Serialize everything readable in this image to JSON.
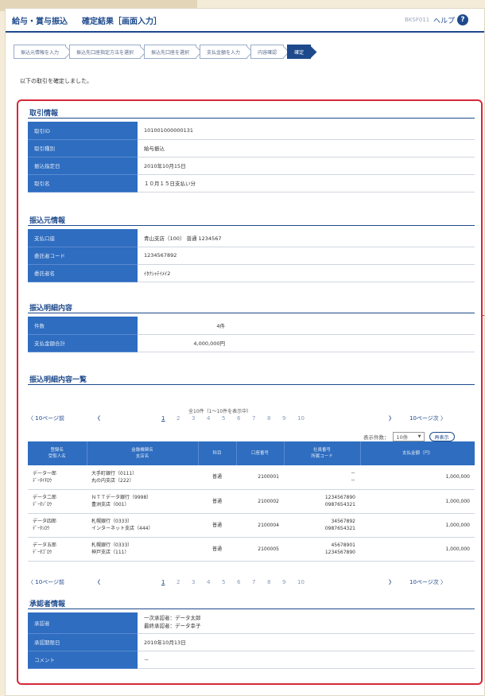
{
  "header": {
    "section": "給与・賞与振込",
    "title": "確定結果［画面入力］",
    "screen_id": "BKSF011",
    "help_label": "ヘルプ",
    "help_icon": "?"
  },
  "steps": [
    "振込元情報を入力",
    "振込先口座指定方法を選択",
    "振込先口座を選択",
    "支払金額を入力",
    "内容確認",
    "確定"
  ],
  "message": "以下の取引を確定しました。",
  "transaction_info": {
    "title": "取引情報",
    "rows": [
      {
        "label": "取引ID",
        "value": "101001000000131"
      },
      {
        "label": "取引種別",
        "value": "給与振込"
      },
      {
        "label": "振込指定日",
        "value": "2010年10月15日"
      },
      {
        "label": "取引名",
        "value": "１０月１５日支払い分"
      }
    ]
  },
  "source_info": {
    "title": "振込元情報",
    "rows": [
      {
        "label": "支払口座",
        "value": "青山支店（100） 普通 1234567"
      },
      {
        "label": "委託者コード",
        "value": "1234567892"
      },
      {
        "label": "委託者名",
        "value": "ｲﾀｸｼｬﾃｲﾒｲ2"
      }
    ]
  },
  "detail_info": {
    "title": "振込明細内容",
    "rows": [
      {
        "label": "件数",
        "value": "4件"
      },
      {
        "label": "支払金額合計",
        "value": "4,000,000円"
      }
    ]
  },
  "detail_list": {
    "title": "振込明細内容一覧",
    "summary": "全10件（1～10件を表示中）",
    "prev_label": "10ページ前",
    "next_label": "10ページ次",
    "prev_arrow": "〈",
    "next_arrow": "〉",
    "pages": [
      "1",
      "2",
      "3",
      "4",
      "5",
      "6",
      "7",
      "8",
      "9",
      "10"
    ],
    "display_count_label": "表示件数：",
    "display_count_value": "10件",
    "redisplay_label": "再表示",
    "headers": [
      [
        "登録名",
        "受取人名"
      ],
      [
        "金融機関名",
        "支店名"
      ],
      [
        "科目"
      ],
      [
        "口座番号"
      ],
      [
        "社員番号",
        "所属コード"
      ],
      [
        "支払金額（円）"
      ]
    ],
    "rows": [
      {
        "name": [
          "データ一郎",
          "ﾃﾞｰﾀｲﾁﾛｳ"
        ],
        "bank": [
          "大手町銀行（0111）",
          "丸の内支店（222）"
        ],
        "type": "普通",
        "account": "2100001",
        "emp": [
          "－",
          "－"
        ],
        "amount": "1,000,000"
      },
      {
        "name": [
          "データ二郎",
          "ﾃﾞｰﾀｼﾞﾛｳ"
        ],
        "bank": [
          "ＮＴＴデータ銀行（9998）",
          "豊洲支店（001）"
        ],
        "type": "普通",
        "account": "2100002",
        "emp": [
          "1234567890",
          "0987654321"
        ],
        "amount": "1,000,000"
      },
      {
        "name": [
          "データ四郎",
          "ﾃﾞｰﾀｼﾛｳ"
        ],
        "bank": [
          "札幌銀行（0333）",
          "インターネット支店（444）"
        ],
        "type": "普通",
        "account": "2100004",
        "emp": [
          "34567892",
          "0987654321"
        ],
        "amount": "1,000,000"
      },
      {
        "name": [
          "データ五郎",
          "ﾃﾞｰﾀｺﾞﾛｳ"
        ],
        "bank": [
          "札幌銀行（0333）",
          "神戸支店（111）"
        ],
        "type": "普通",
        "account": "2100005",
        "emp": [
          "45678901",
          "1234567890"
        ],
        "amount": "1,000,000"
      }
    ]
  },
  "approver_info": {
    "title": "承認者情報",
    "rows": [
      {
        "label": "承認者",
        "value": "一次承認者：データ太郎",
        "value2": "最終承認者：データ幸子"
      },
      {
        "label": "承認期限日",
        "value": "2010年10月13日"
      },
      {
        "label": "コメント",
        "value": "－"
      }
    ]
  },
  "colors": {
    "brand": "#1e4a8c",
    "table_header": "#2e6dc0",
    "highlight_border": "#d6283a"
  }
}
